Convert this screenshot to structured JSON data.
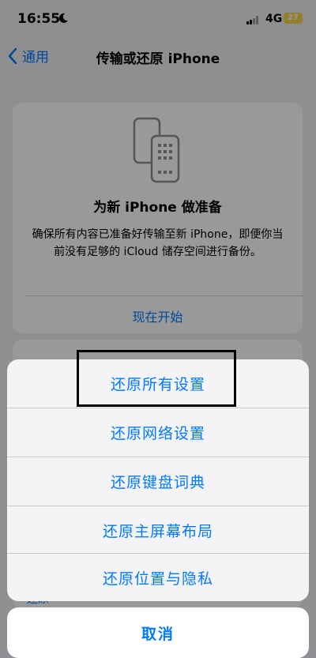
{
  "status_bar": {
    "time": "16:55",
    "network": "4G",
    "battery": "27"
  },
  "nav": {
    "back_label": "通用",
    "title": "传输或还原 iPhone"
  },
  "prepare_card": {
    "title": "为新 iPhone 做准备",
    "description": "确保所有内容已准备好传输至新 iPhone，即便你当前没有足够的 iCloud 储存空间进行备份。",
    "action_label": "现在开始"
  },
  "background_label": "还原",
  "action_sheet": {
    "items": [
      {
        "label": "还原所有设置"
      },
      {
        "label": "还原网络设置"
      },
      {
        "label": "还原键盘词典"
      },
      {
        "label": "还原主屏幕布局"
      },
      {
        "label": "还原位置与隐私"
      }
    ],
    "cancel_label": "取消"
  },
  "colors": {
    "accent": "#007aff",
    "battery": "#f7d64a"
  }
}
